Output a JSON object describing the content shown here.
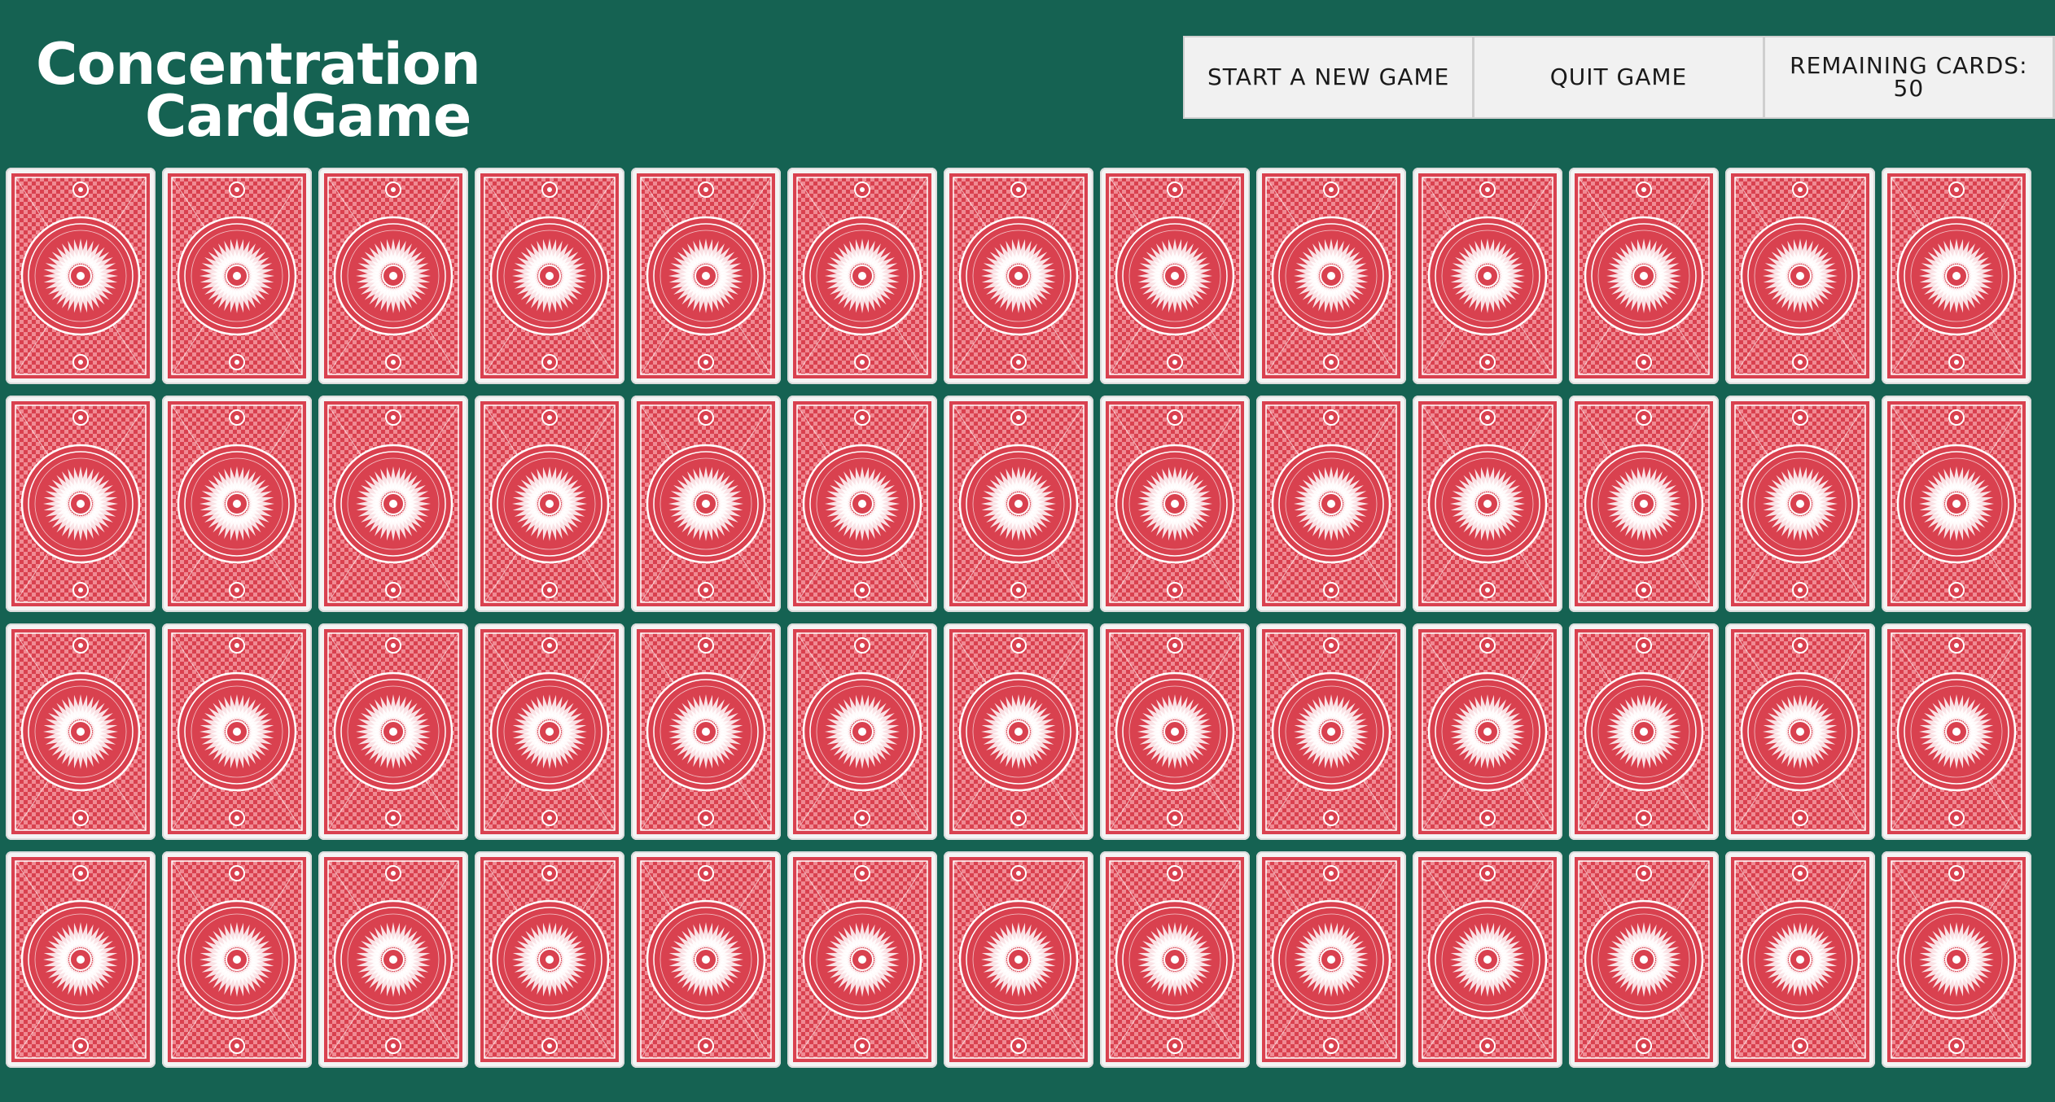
{
  "logo": {
    "line1": "Concentration",
    "line2": "CardGame"
  },
  "controls": {
    "new_game": "START A NEW GAME",
    "quit": "QUIT GAME",
    "remaining_label": "REMAINING CARDS:",
    "remaining_count": "50"
  },
  "board": {
    "rows": 4,
    "cols": 13,
    "card_state": "face-down"
  },
  "colors": {
    "table": "#156252",
    "card_back": "#d9414f",
    "card_border": "#f4f4f4"
  }
}
